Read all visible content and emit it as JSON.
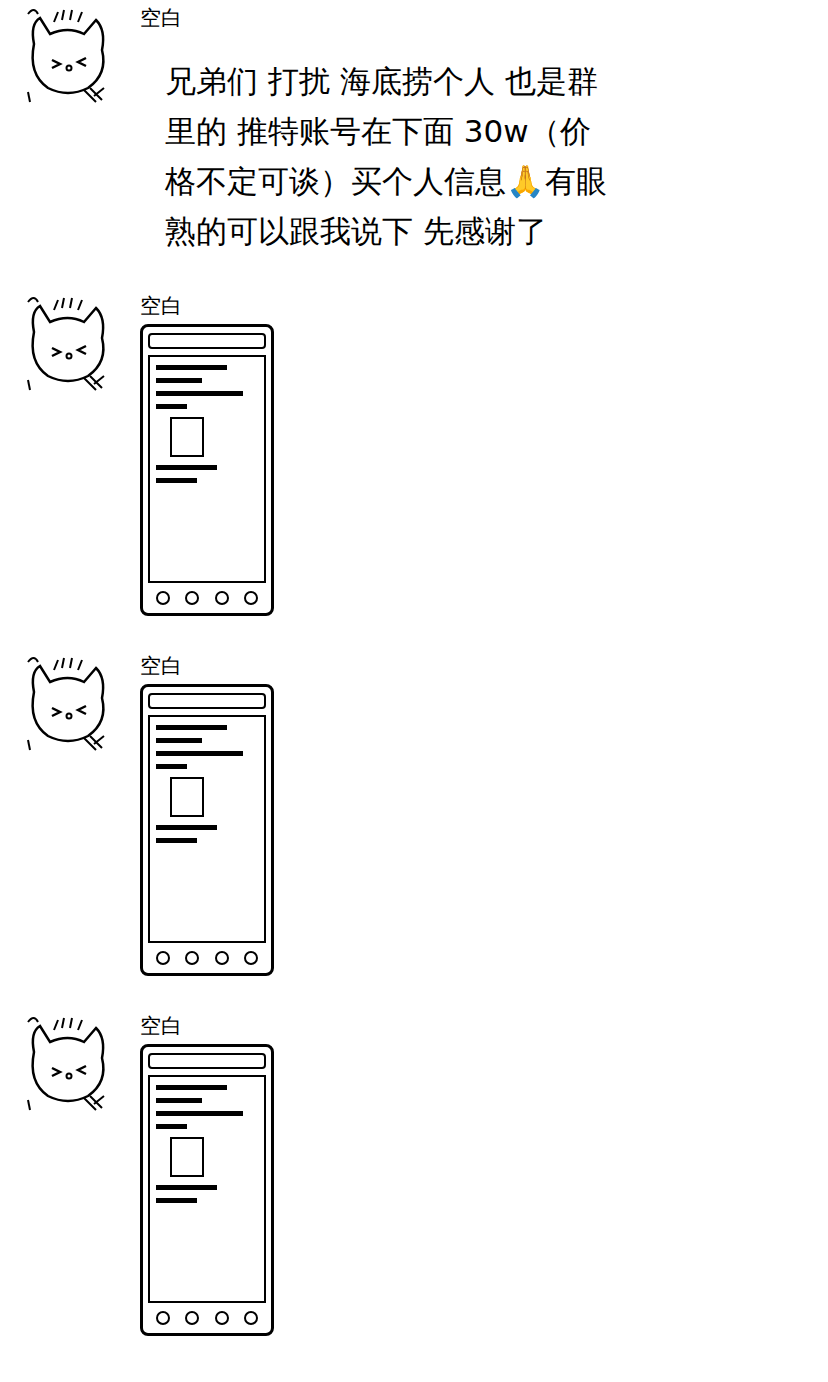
{
  "messages": [
    {
      "sender": "空白",
      "kind": "text",
      "lines": [
        "兄弟们 打扰 海底捞个人 也是群",
        "里的 推特账号在下面 30w（价",
        "格不定可谈）买个人信息🙏有眼",
        "熟的可以跟我说下 先感谢了"
      ]
    },
    {
      "sender": "空白",
      "kind": "image"
    },
    {
      "sender": "空白",
      "kind": "image"
    },
    {
      "sender": "空白",
      "kind": "image"
    }
  ]
}
